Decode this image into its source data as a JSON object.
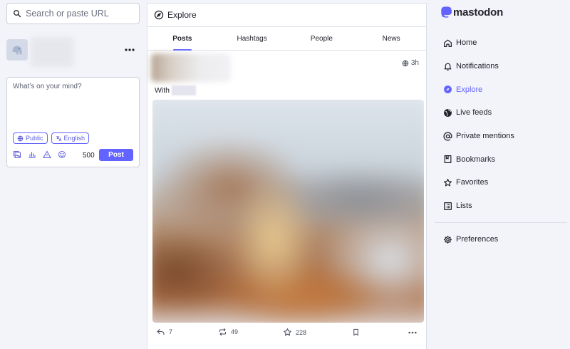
{
  "search": {
    "placeholder": "Search or paste URL"
  },
  "composer": {
    "placeholder": "What’s on your mind?",
    "visibility": "Public",
    "language": "English",
    "char_count": "500",
    "post_label": "Post"
  },
  "explore": {
    "title": "Explore",
    "tabs": [
      {
        "label": "Posts"
      },
      {
        "label": "Hashtags"
      },
      {
        "label": "People"
      },
      {
        "label": "News"
      }
    ]
  },
  "status": {
    "time": "3h",
    "text": "With",
    "replies": "7",
    "boosts": "49",
    "favorites": "228"
  },
  "brand": {
    "name": "mastodon",
    "accent": "#6364ff"
  },
  "nav": {
    "items": [
      {
        "label": "Home",
        "icon": "home-icon"
      },
      {
        "label": "Notifications",
        "icon": "bell-icon"
      },
      {
        "label": "Explore",
        "icon": "compass-icon"
      },
      {
        "label": "Live feeds",
        "icon": "globe-icon"
      },
      {
        "label": "Private mentions",
        "icon": "at-icon"
      },
      {
        "label": "Bookmarks",
        "icon": "bookmark-icon"
      },
      {
        "label": "Favorites",
        "icon": "star-icon"
      },
      {
        "label": "Lists",
        "icon": "list-icon"
      }
    ],
    "preferences": "Preferences"
  }
}
